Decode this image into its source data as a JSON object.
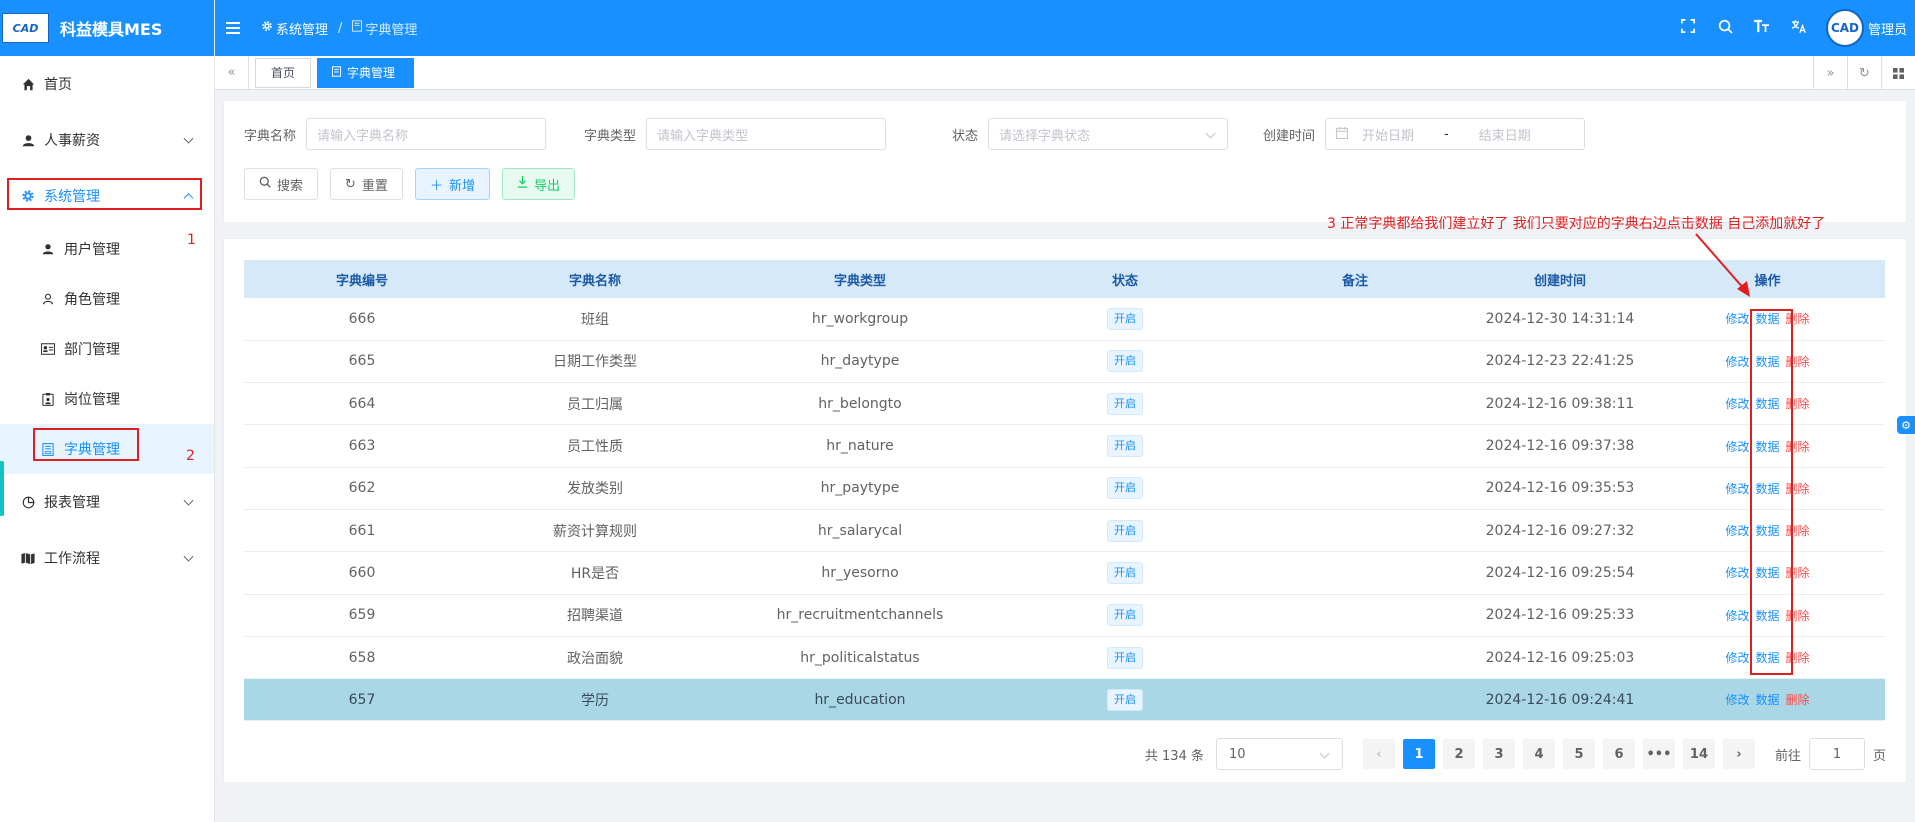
{
  "app": {
    "title": "科益模具MES",
    "logo_text": "CAD"
  },
  "sidebar": {
    "items": [
      {
        "label": "首页",
        "icon": "home-icon"
      },
      {
        "label": "人事薪资",
        "icon": "user-icon"
      },
      {
        "label": "系统管理",
        "icon": "gear-icon"
      },
      {
        "label": "用户管理",
        "icon": "user-icon"
      },
      {
        "label": "角色管理",
        "icon": "person-outline-icon"
      },
      {
        "label": "部门管理",
        "icon": "id-card-icon"
      },
      {
        "label": "岗位管理",
        "icon": "badge-icon"
      },
      {
        "label": "字典管理",
        "icon": "dictionary-icon"
      },
      {
        "label": "报表管理",
        "icon": "pie-chart-icon"
      },
      {
        "label": "工作流程",
        "icon": "map-icon"
      }
    ],
    "annotations": [
      "1",
      "2"
    ]
  },
  "header": {
    "breadcrumb": [
      "系统管理",
      "字典管理"
    ],
    "username": "管理员",
    "avatar_text": "CAD",
    "icons": [
      "fullscreen-icon",
      "search-icon",
      "font-size-icon",
      "translate-icon"
    ]
  },
  "tags": {
    "items": [
      "首页",
      "字典管理"
    ],
    "active": "字典管理"
  },
  "search": {
    "dict_name_label": "字典名称",
    "dict_name_placeholder": "请输入字典名称",
    "dict_type_label": "字典类型",
    "dict_type_placeholder": "请输入字典类型",
    "status_label": "状态",
    "status_placeholder": "请选择字典状态",
    "created_label": "创建时间",
    "start_placeholder": "开始日期",
    "range_sep": "-",
    "end_placeholder": "结束日期",
    "buttons": {
      "search": "搜索",
      "reset": "重置",
      "add": "新增",
      "export": "导出"
    }
  },
  "annotation_text": "3 正常字典都给我们建立好了 我们只要对应的字典右边点击数据 自己添加就好了",
  "table": {
    "headers": [
      "字典编号",
      "字典名称",
      "字典类型",
      "状态",
      "备注",
      "创建时间",
      "操作"
    ],
    "actions": {
      "edit": "修改",
      "data": "数据",
      "delete": "删除"
    },
    "rows": [
      {
        "id": "666",
        "name": "班组",
        "type": "hr_workgroup",
        "status": "开启",
        "remark": "",
        "created": "2024-12-30 14:31:14"
      },
      {
        "id": "665",
        "name": "日期工作类型",
        "type": "hr_daytype",
        "status": "开启",
        "remark": "",
        "created": "2024-12-23 22:41:25"
      },
      {
        "id": "664",
        "name": "员工归属",
        "type": "hr_belongto",
        "status": "开启",
        "remark": "",
        "created": "2024-12-16 09:38:11"
      },
      {
        "id": "663",
        "name": "员工性质",
        "type": "hr_nature",
        "status": "开启",
        "remark": "",
        "created": "2024-12-16 09:37:38"
      },
      {
        "id": "662",
        "name": "发放类别",
        "type": "hr_paytype",
        "status": "开启",
        "remark": "",
        "created": "2024-12-16 09:35:53"
      },
      {
        "id": "661",
        "name": "薪资计算规则",
        "type": "hr_salarycal",
        "status": "开启",
        "remark": "",
        "created": "2024-12-16 09:27:32"
      },
      {
        "id": "660",
        "name": "HR是否",
        "type": "hr_yesorno",
        "status": "开启",
        "remark": "",
        "created": "2024-12-16 09:25:54"
      },
      {
        "id": "659",
        "name": "招聘渠道",
        "type": "hr_recruitmentchannels",
        "status": "开启",
        "remark": "",
        "created": "2024-12-16 09:25:33"
      },
      {
        "id": "658",
        "name": "政治面貌",
        "type": "hr_politicalstatus",
        "status": "开启",
        "remark": "",
        "created": "2024-12-16 09:25:03"
      },
      {
        "id": "657",
        "name": "学历",
        "type": "hr_education",
        "status": "开启",
        "remark": "",
        "created": "2024-12-16 09:24:41"
      }
    ]
  },
  "pagination": {
    "total": "共 134 条",
    "page_size": "10",
    "pages": [
      "1",
      "2",
      "3",
      "4",
      "5",
      "6",
      "•••",
      "14"
    ],
    "current": "1",
    "goto_label": "前往",
    "goto_value": "1",
    "goto_suffix": "页"
  },
  "colors": {
    "primary": "#1890ff",
    "annotation": "#e02020",
    "selected_row": "#a9d7e6",
    "danger": "#ff4949",
    "success": "#13ce66"
  }
}
